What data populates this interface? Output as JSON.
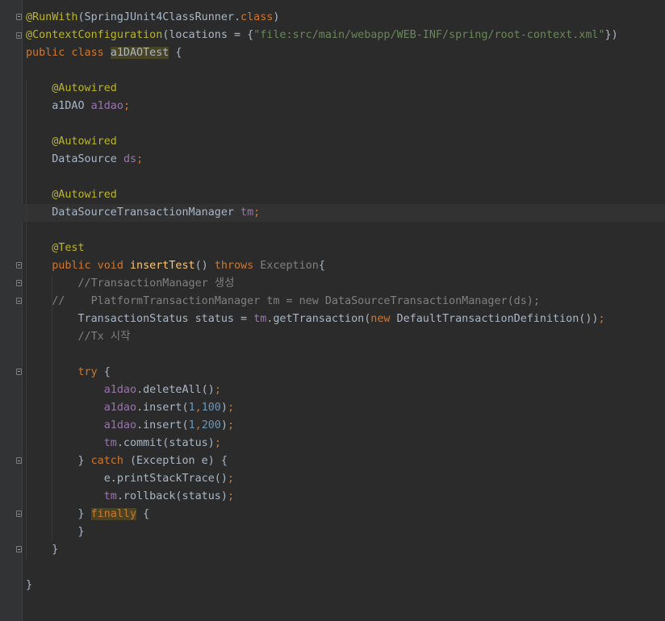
{
  "editor": {
    "lines": [
      [
        {
          "t": "@RunWith",
          "c": "ann"
        },
        {
          "t": "(SpringJUnit4ClassRunner.",
          "c": "t"
        },
        {
          "t": "class",
          "c": "kw"
        },
        {
          "t": ")",
          "c": "t"
        }
      ],
      [
        {
          "t": "@ContextConfiguration",
          "c": "ann"
        },
        {
          "t": "(locations = {",
          "c": "t"
        },
        {
          "t": "\"file:src/main/webapp/WEB-INF/spring/root-context.xml\"",
          "c": "str"
        },
        {
          "t": "})",
          "c": "t"
        }
      ],
      [
        {
          "t": "public class ",
          "c": "kw"
        },
        {
          "t": "a1DAOTest",
          "c": "t hl"
        },
        {
          "t": " {",
          "c": "t"
        }
      ],
      [],
      [
        {
          "t": "    ",
          "c": "t"
        },
        {
          "t": "@Autowired",
          "c": "ann"
        }
      ],
      [
        {
          "t": "    a1DAO ",
          "c": "t"
        },
        {
          "t": "a1dao",
          "c": "fld"
        },
        {
          "t": ";",
          "c": "kw"
        }
      ],
      [],
      [
        {
          "t": "    ",
          "c": "t"
        },
        {
          "t": "@Autowired",
          "c": "ann"
        }
      ],
      [
        {
          "t": "    DataSource ",
          "c": "t"
        },
        {
          "t": "ds",
          "c": "fld"
        },
        {
          "t": ";",
          "c": "kw"
        }
      ],
      [],
      [
        {
          "t": "    ",
          "c": "t"
        },
        {
          "t": "@Autowired",
          "c": "ann"
        }
      ],
      [
        {
          "t": "    DataSourceTransactionManager ",
          "c": "t"
        },
        {
          "t": "tm",
          "c": "fld"
        },
        {
          "t": ";",
          "c": "kw"
        }
      ],
      [],
      [
        {
          "t": "    ",
          "c": "t"
        },
        {
          "t": "@Test",
          "c": "ann"
        }
      ],
      [
        {
          "t": "    ",
          "c": "t"
        },
        {
          "t": "public void ",
          "c": "kw"
        },
        {
          "t": "insertTest",
          "c": "fn"
        },
        {
          "t": "() ",
          "c": "t"
        },
        {
          "t": "throws ",
          "c": "kw"
        },
        {
          "t": "Exception",
          "c": "cmt"
        },
        {
          "t": "{",
          "c": "t"
        }
      ],
      [
        {
          "t": "        ",
          "c": "t"
        },
        {
          "t": "//TransactionManager 생성",
          "c": "cmt"
        }
      ],
      [
        {
          "t": "    //    PlatformTransactionManager tm = new DataSourceTransactionManager(ds);",
          "c": "cmt"
        }
      ],
      [
        {
          "t": "        TransactionStatus status = ",
          "c": "t"
        },
        {
          "t": "tm",
          "c": "fld"
        },
        {
          "t": ".getTransaction(",
          "c": "t"
        },
        {
          "t": "new ",
          "c": "kw"
        },
        {
          "t": "DefaultTransactionDefinition())",
          "c": "t"
        },
        {
          "t": ";",
          "c": "kw"
        }
      ],
      [
        {
          "t": "        ",
          "c": "t"
        },
        {
          "t": "//Tx 시작",
          "c": "cmt"
        }
      ],
      [],
      [
        {
          "t": "        ",
          "c": "t"
        },
        {
          "t": "try ",
          "c": "kw"
        },
        {
          "t": "{",
          "c": "t"
        }
      ],
      [
        {
          "t": "            ",
          "c": "t"
        },
        {
          "t": "a1dao",
          "c": "fld"
        },
        {
          "t": ".deleteAll()",
          "c": "t"
        },
        {
          "t": ";",
          "c": "kw"
        }
      ],
      [
        {
          "t": "            ",
          "c": "t"
        },
        {
          "t": "a1dao",
          "c": "fld"
        },
        {
          "t": ".insert(",
          "c": "t"
        },
        {
          "t": "1",
          "c": "num"
        },
        {
          "t": ",",
          "c": "kw"
        },
        {
          "t": "100",
          "c": "num"
        },
        {
          "t": ")",
          "c": "t"
        },
        {
          "t": ";",
          "c": "kw"
        }
      ],
      [
        {
          "t": "            ",
          "c": "t"
        },
        {
          "t": "a1dao",
          "c": "fld"
        },
        {
          "t": ".insert(",
          "c": "t"
        },
        {
          "t": "1",
          "c": "num"
        },
        {
          "t": ",",
          "c": "kw"
        },
        {
          "t": "200",
          "c": "num"
        },
        {
          "t": ")",
          "c": "t"
        },
        {
          "t": ";",
          "c": "kw"
        }
      ],
      [
        {
          "t": "            ",
          "c": "t"
        },
        {
          "t": "tm",
          "c": "fld"
        },
        {
          "t": ".commit(status)",
          "c": "t"
        },
        {
          "t": ";",
          "c": "kw"
        }
      ],
      [
        {
          "t": "        } ",
          "c": "t"
        },
        {
          "t": "catch ",
          "c": "kw"
        },
        {
          "t": "(Exception e) {",
          "c": "t"
        }
      ],
      [
        {
          "t": "            e.printStackTrace()",
          "c": "t"
        },
        {
          "t": ";",
          "c": "kw"
        }
      ],
      [
        {
          "t": "            ",
          "c": "t"
        },
        {
          "t": "tm",
          "c": "fld"
        },
        {
          "t": ".rollback(status)",
          "c": "t"
        },
        {
          "t": ";",
          "c": "kw"
        }
      ],
      [
        {
          "t": "        } ",
          "c": "t"
        },
        {
          "t": "finally",
          "c": "kw hl"
        },
        {
          "t": " {",
          "c": "t"
        }
      ],
      [
        {
          "t": "        }",
          "c": "t"
        }
      ],
      [
        {
          "t": "    }",
          "c": "t"
        }
      ],
      [],
      [
        {
          "t": "}",
          "c": "t"
        }
      ]
    ]
  }
}
